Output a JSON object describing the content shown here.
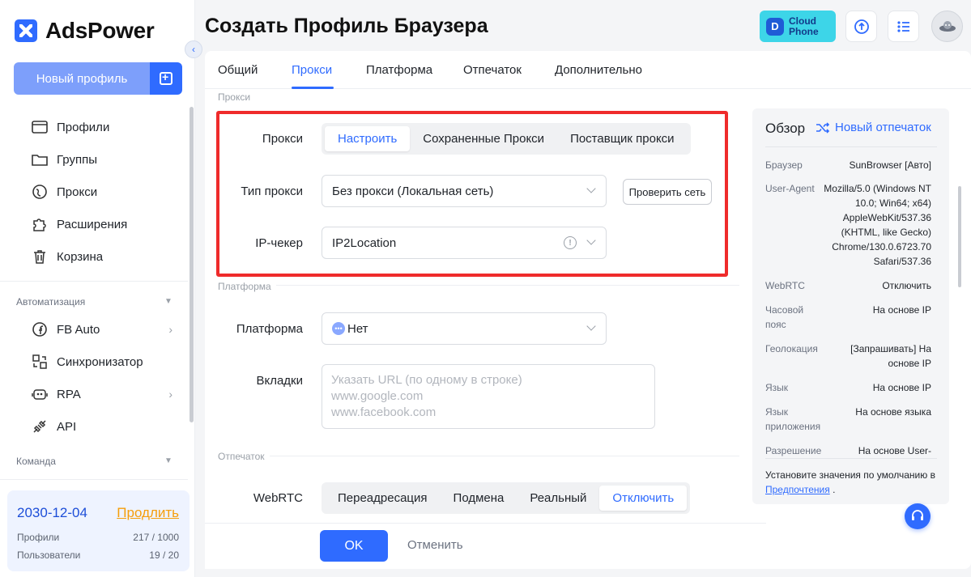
{
  "app": {
    "name": "AdsPower"
  },
  "sidebar": {
    "new_profile_label": "Новый профиль",
    "items": [
      {
        "label": "Профили",
        "icon": "profiles-icon"
      },
      {
        "label": "Группы",
        "icon": "folder-icon"
      },
      {
        "label": "Прокси",
        "icon": "proxy-icon"
      },
      {
        "label": "Расширения",
        "icon": "puzzle-icon"
      },
      {
        "label": "Корзина",
        "icon": "trash-icon"
      }
    ],
    "automation_label": "Автоматизация",
    "automation_items": [
      {
        "label": "FB Auto",
        "icon": "facebook-icon"
      },
      {
        "label": "Синхронизатор",
        "icon": "sync-icon"
      },
      {
        "label": "RPA",
        "icon": "robot-icon"
      },
      {
        "label": "API",
        "icon": "api-plug-icon"
      }
    ],
    "team_label": "Команда",
    "plan": {
      "date": "2030-12-04",
      "renew": "Продлить",
      "profiles_label": "Профили",
      "profiles_value": "217 / 1000",
      "users_label": "Пользователи",
      "users_value": "19 / 20"
    }
  },
  "header": {
    "title": "Создать Профиль Браузера",
    "cloud_phone_line1": "Cloud",
    "cloud_phone_line2": "Phone"
  },
  "tabs": [
    "Общий",
    "Прокси",
    "Платформа",
    "Отпечаток",
    "Дополнительно"
  ],
  "active_tab": "Прокси",
  "proxy_section": {
    "title": "Прокси",
    "proxy_label": "Прокси",
    "segments": [
      "Настроить",
      "Сохраненные Прокси",
      "Поставщик прокси"
    ],
    "active_segment": "Настроить",
    "type_label": "Тип прокси",
    "type_value": "Без прокси (Локальная сеть)",
    "check_button": "Проверить сеть",
    "checker_label": "IP-чекер",
    "checker_value": "IP2Location"
  },
  "platform_section": {
    "title": "Платформа",
    "platform_label": "Платформа",
    "platform_value": "Нет",
    "tabs_label": "Вкладки",
    "tabs_placeholder_lines": [
      "Указать URL (по одному в строке)",
      "www.google.com",
      "www.facebook.com"
    ]
  },
  "fingerprint_section": {
    "title": "Отпечаток",
    "webrtc_label": "WebRTC",
    "webrtc_options": [
      "Переадресация",
      "Подмена",
      "Реальный",
      "Отключить"
    ],
    "webrtc_active": "Отключить"
  },
  "overview": {
    "title": "Обзор",
    "new_fingerprint": "Новый отпечаток",
    "rows": [
      {
        "key": "Браузер",
        "value": "SunBrowser [Авто]"
      },
      {
        "key": "User-Agent",
        "value": "Mozilla/5.0 (Windows NT 10.0; Win64; x64) AppleWebKit/537.36 (KHTML, like Gecko) Chrome/130.0.6723.70 Safari/537.36"
      },
      {
        "key": "WebRTC",
        "value": "Отключить"
      },
      {
        "key": "Часовой пояс",
        "value": "На основе IP"
      },
      {
        "key": "Геолокация",
        "value": "[Запрашивать] На основе IP"
      },
      {
        "key": "Язык",
        "value": "На основе IP"
      },
      {
        "key": "Язык приложения",
        "value": "На основе языка"
      },
      {
        "key": "Разрешение",
        "value": "На основе User-"
      }
    ],
    "note_text": "Установите значения по умолчанию в ",
    "note_link": "Предпочтения",
    "note_end": " ."
  },
  "footer": {
    "ok": "OK",
    "cancel": "Отменить"
  },
  "colors": {
    "accent": "#2f6bff",
    "highlight_border": "#ef2b2b",
    "renew": "#f59e0b"
  }
}
